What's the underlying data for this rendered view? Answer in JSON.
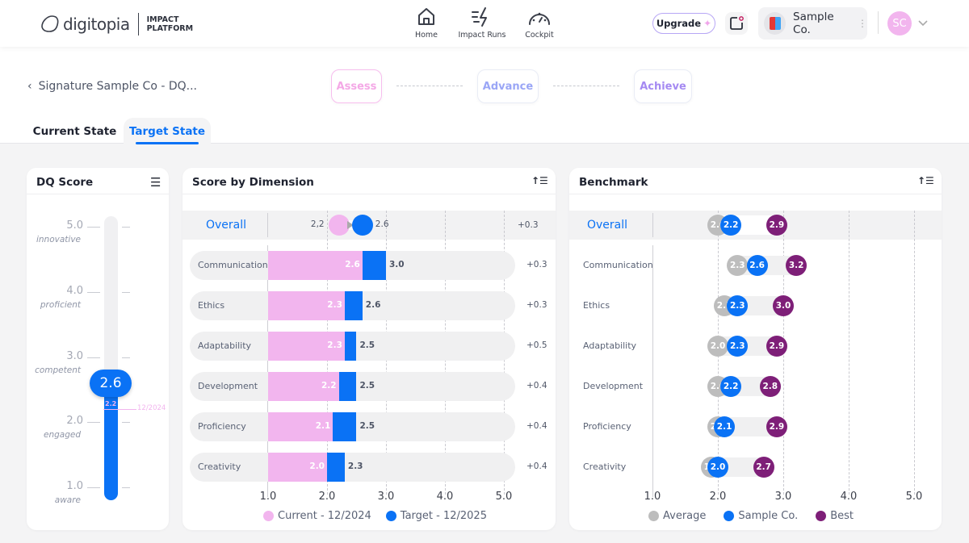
{
  "header": {
    "brand": "digitopia",
    "product_line1": "IMPACT",
    "product_line2": "PLATFORM",
    "nav": [
      {
        "label": "Home",
        "icon": "home-icon"
      },
      {
        "label": "Impact Runs",
        "icon": "lightning-icon"
      },
      {
        "label": "Cockpit",
        "icon": "gauge-icon"
      }
    ],
    "upgrade_label": "Upgrade",
    "org_name": "Sample Co.",
    "avatar_initials": "SC"
  },
  "breadcrumb": {
    "title": "Signature Sample Co - DQ..."
  },
  "steps": [
    {
      "label": "Assess",
      "color": "#f4a8e6"
    },
    {
      "label": "Advance",
      "color": "#9aa6f6"
    },
    {
      "label": "Achieve",
      "color": "#a58af2"
    }
  ],
  "tabs": [
    {
      "label": "Current State",
      "active": false
    },
    {
      "label": "Target State",
      "active": true
    }
  ],
  "colors": {
    "current": "#f2b5ee",
    "target": "#0a72f5",
    "average": "#bdbdbd",
    "best": "#7e1f78",
    "accent": "#0a72f5"
  },
  "dq_score": {
    "title": "DQ Score",
    "levels": [
      {
        "value": "5.0",
        "name": "innovative"
      },
      {
        "value": "4.0",
        "name": "proficient"
      },
      {
        "value": "3.0",
        "name": "competent"
      },
      {
        "value": "2.0",
        "name": "engaged"
      },
      {
        "value": "1.0",
        "name": "aware"
      }
    ],
    "target": 2.6,
    "target_label": "2.6",
    "current": 2.2,
    "current_label": "2.2",
    "current_date": "12/2024"
  },
  "chart_data": [
    {
      "type": "bar",
      "title": "Score by Dimension",
      "xlim": [
        1.0,
        5.0
      ],
      "ticks": [
        "1.0",
        "2.0",
        "3.0",
        "4.0",
        "5.0"
      ],
      "overall": {
        "label": "Overall",
        "current": 2.2,
        "current_label": "2,2",
        "target": 2.6,
        "target_label": "2.6",
        "delta": "+0.3"
      },
      "categories": [
        "Communication",
        "Ethics",
        "Adaptability",
        "Development",
        "Proficiency",
        "Creativity"
      ],
      "series": [
        {
          "name": "Current - 12/2024",
          "values": [
            2.6,
            2.3,
            2.3,
            2.2,
            2.1,
            2.0
          ]
        },
        {
          "name": "Target - 12/2025",
          "values": [
            3.0,
            2.6,
            2.5,
            2.5,
            2.5,
            2.3
          ]
        }
      ],
      "deltas": [
        "+0.3",
        "+0.3",
        "+0.5",
        "+0.4",
        "+0.4",
        "+0.4"
      ],
      "legend": "bottom"
    },
    {
      "type": "scatter",
      "title": "Benchmark",
      "xlim": [
        1.0,
        5.0
      ],
      "ticks": [
        "1.0",
        "2.0",
        "3.0",
        "4.0",
        "5.0"
      ],
      "overall": {
        "label": "Overall",
        "average": 2.0,
        "sample": 2.2,
        "best": 2.9
      },
      "categories": [
        "Communication",
        "Ethics",
        "Adaptability",
        "Development",
        "Proficiency",
        "Creativity"
      ],
      "series": [
        {
          "name": "Average",
          "values": [
            2.3,
            2.1,
            2.0,
            2.0,
            2.0,
            1.9
          ]
        },
        {
          "name": "Sample Co.",
          "values": [
            2.6,
            2.3,
            2.3,
            2.2,
            2.1,
            2.0
          ]
        },
        {
          "name": "Best",
          "values": [
            3.2,
            3.0,
            2.9,
            2.8,
            2.9,
            2.7
          ]
        }
      ],
      "legend": "bottom"
    }
  ]
}
